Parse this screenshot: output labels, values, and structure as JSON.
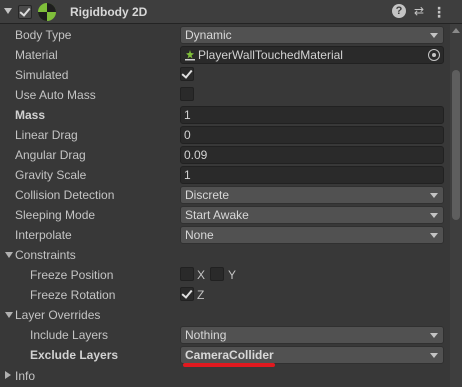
{
  "component": {
    "title": "Rigidbody 2D",
    "help_glyph": "?",
    "presets_glyph": "⇄",
    "menu_glyph": "⋮"
  },
  "fields": {
    "body_type": {
      "label": "Body Type",
      "value": "Dynamic"
    },
    "material": {
      "label": "Material",
      "value": "PlayerWallTouchedMaterial"
    },
    "simulated": {
      "label": "Simulated",
      "checked": true
    },
    "use_auto_mass": {
      "label": "Use Auto Mass",
      "checked": false
    },
    "mass": {
      "label": "Mass",
      "value": "1"
    },
    "linear_drag": {
      "label": "Linear Drag",
      "value": "0"
    },
    "angular_drag": {
      "label": "Angular Drag",
      "value": "0.09"
    },
    "gravity_scale": {
      "label": "Gravity Scale",
      "value": "1"
    },
    "collision_detection": {
      "label": "Collision Detection",
      "value": "Discrete"
    },
    "sleeping_mode": {
      "label": "Sleeping Mode",
      "value": "Start Awake"
    },
    "interpolate": {
      "label": "Interpolate",
      "value": "None"
    }
  },
  "constraints": {
    "label": "Constraints",
    "freeze_position": {
      "label": "Freeze Position",
      "x_label": "X",
      "y_label": "Y",
      "x_checked": false,
      "y_checked": false
    },
    "freeze_rotation": {
      "label": "Freeze Rotation",
      "z_label": "Z",
      "z_checked": true
    }
  },
  "layer_overrides": {
    "label": "Layer Overrides",
    "include_layers": {
      "label": "Include Layers",
      "value": "Nothing"
    },
    "exclude_layers": {
      "label": "Exclude Layers",
      "value": "CameraCollider"
    }
  },
  "info": {
    "label": "Info"
  },
  "colors": {
    "annotation_underline": "#e0191f",
    "component_icon": "#7fbf3a"
  }
}
